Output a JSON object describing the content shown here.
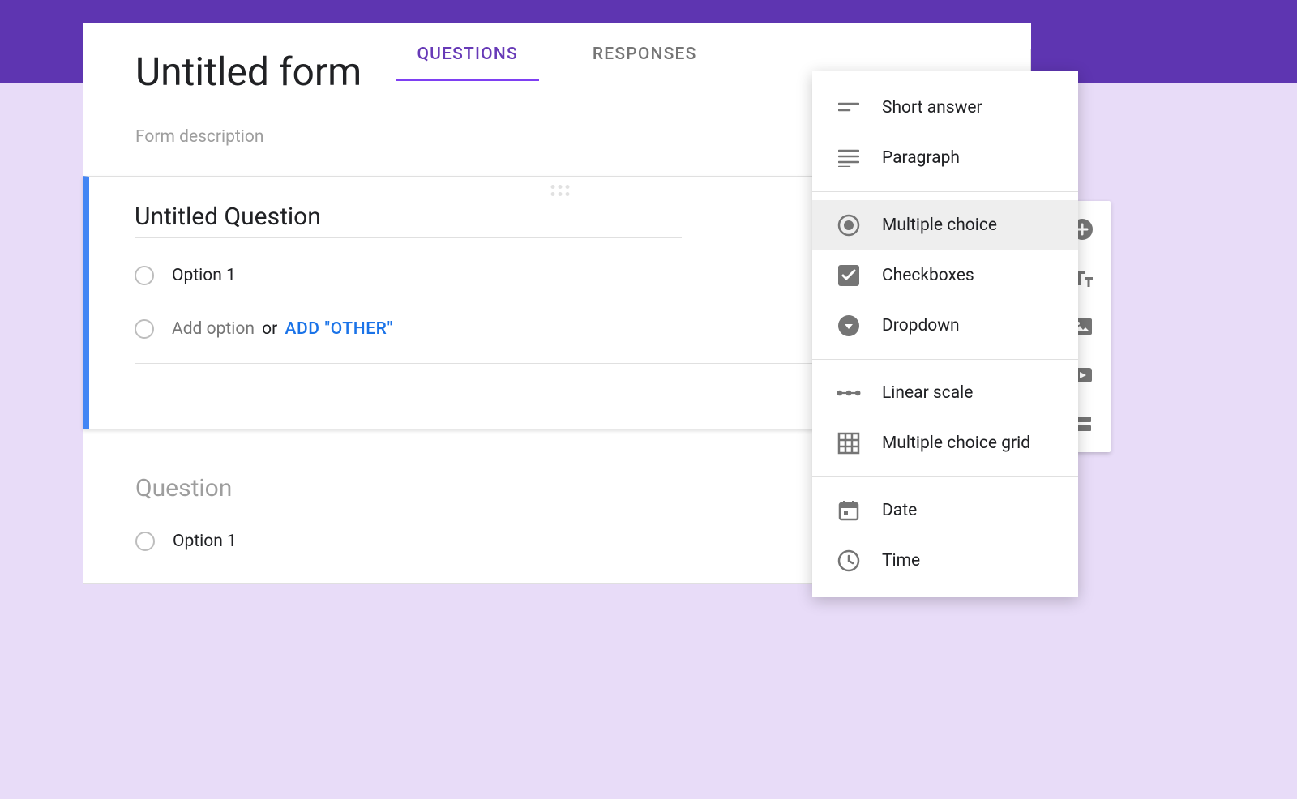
{
  "tabs": {
    "questions": "QUESTIONS",
    "responses": "RESPONSES",
    "active": "questions"
  },
  "form": {
    "title": "Untitled form",
    "description_placeholder": "Form description"
  },
  "active_question": {
    "title": "Untitled Question",
    "options": [
      "Option 1"
    ],
    "add_option_label": "Add option",
    "add_or_label": "or",
    "add_other_label": "ADD \"OTHER\""
  },
  "second_question": {
    "title_placeholder": "Question",
    "options": [
      "Option 1"
    ]
  },
  "type_menu": {
    "selected": "multiple_choice",
    "groups": [
      [
        "short_answer",
        "paragraph"
      ],
      [
        "multiple_choice",
        "checkboxes",
        "dropdown"
      ],
      [
        "linear_scale",
        "multiple_choice_grid"
      ],
      [
        "date",
        "time"
      ]
    ],
    "labels": {
      "short_answer": "Short answer",
      "paragraph": "Paragraph",
      "multiple_choice": "Multiple choice",
      "checkboxes": "Checkboxes",
      "dropdown": "Dropdown",
      "linear_scale": "Linear scale",
      "multiple_choice_grid": "Multiple choice grid",
      "date": "Date",
      "time": "Time"
    }
  },
  "side_tools": {
    "add_question": "add-question",
    "add_title": "add-title",
    "add_image": "add-image",
    "add_video": "add-video",
    "add_section": "add-section"
  },
  "colors": {
    "accent": "#673ab7",
    "active_border": "#4285f4",
    "link": "#1a73e8"
  }
}
